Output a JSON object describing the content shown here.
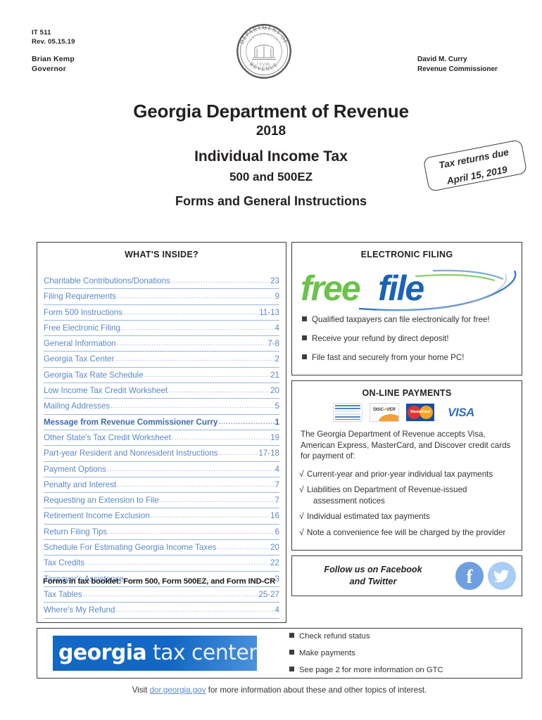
{
  "header": {
    "form_number": "IT 511",
    "revision": "Rev. 05.15.19",
    "governor_name": "Brian Kemp",
    "governor_title": "Governor",
    "commissioner_name": "David M. Curry",
    "commissioner_title": "Revenue Commissioner",
    "seal_outer_top": "DEPARTMENT OF",
    "seal_outer_bottom": "REVENUE",
    "seal_inner_top": "STATE OF GEORGIA",
    "seal_year": "1776"
  },
  "title": {
    "line1": "Georgia Department of Revenue",
    "line2": "2018",
    "line3": "Individual Income Tax",
    "line4": "500 and 500EZ",
    "line5": "Forms and General Instructions"
  },
  "due_badge": {
    "line1": "Tax returns due",
    "line2": "April 15, 2019"
  },
  "whats_inside": {
    "heading": "WHAT'S INSIDE?",
    "items": [
      {
        "label": "Charitable Contributions/Donations",
        "page": "23",
        "bold": false
      },
      {
        "label": "Filing Requirements",
        "page": "9",
        "bold": false
      },
      {
        "label": "Form 500 Instructions",
        "page": "11-13",
        "bold": false
      },
      {
        "label": "Free Electronic Filing",
        "page": "4",
        "bold": false
      },
      {
        "label": "General Information",
        "page": "7-8",
        "bold": false
      },
      {
        "label": "Georgia Tax Center",
        "page": "2",
        "bold": false
      },
      {
        "label": "Georgia Tax Rate Schedule",
        "page": "21",
        "bold": false
      },
      {
        "label": "Low Income Tax Credit Worksheet",
        "page": "20",
        "bold": false
      },
      {
        "label": "Mailing Addresses",
        "page": "5",
        "bold": false
      },
      {
        "label": "Message from Revenue Commissioner Curry",
        "page": "1",
        "bold": true
      },
      {
        "label": "Other State's Tax Credit Worksheet",
        "page": "19",
        "bold": false
      },
      {
        "label": "Part-year Resident and Nonresident Instructions",
        "page": "17-18",
        "bold": false
      },
      {
        "label": "Payment Options",
        "page": "4",
        "bold": false
      },
      {
        "label": "Penalty and Interest",
        "page": "7",
        "bold": false
      },
      {
        "label": "Requesting an Extension to File",
        "page": "7",
        "bold": false
      },
      {
        "label": "Retirement Income Exclusion",
        "page": "16",
        "bold": false
      },
      {
        "label": "Return Filing Tips",
        "page": "6",
        "bold": false
      },
      {
        "label": "Schedule For Estimating Georgia Income Taxes",
        "page": "20",
        "bold": false
      },
      {
        "label": "Tax Credits",
        "page": "22",
        "bold": false
      },
      {
        "label": "Taxpayer's Assistance",
        "page": "3",
        "bold": false
      },
      {
        "label": "Tax Tables",
        "page": "25-27",
        "bold": false
      },
      {
        "label": "Where's My Refund",
        "page": "4",
        "bold": false
      }
    ],
    "forms_note": "Forms in tax booklet: Form 500, Form 500EZ, and  Form IND-CR"
  },
  "electronic_filing": {
    "heading": "ELECTRONIC FILING",
    "logo_free": "free",
    "logo_file": "file",
    "bullets": [
      "Qualified taxpayers can file electronically for free!",
      "Receive your refund by direct deposit!",
      "File fast and securely from your home PC!"
    ]
  },
  "online_payments": {
    "heading": "ON-LINE PAYMENTS",
    "cards": [
      {
        "name": "american-express",
        "label": "AMERICAN EXPRESS"
      },
      {
        "name": "discover",
        "label": "DISCOVER"
      },
      {
        "name": "mastercard",
        "label": "MasterCard"
      },
      {
        "name": "visa",
        "label": "VISA"
      }
    ],
    "intro": "The Georgia Department of Revenue accepts Visa, American Express, MasterCard, and Discover credit cards for payment of:",
    "check_symbol": "√",
    "items": [
      {
        "text": "Current-year and prior-year individual tax payments",
        "sub": ""
      },
      {
        "text": "Liabilities on Department of Revenue-issued",
        "sub": "assessment notices"
      },
      {
        "text": "Individual estimated tax payments",
        "sub": ""
      },
      {
        "text": "Note a convenience fee will be charged by the provider",
        "sub": ""
      }
    ]
  },
  "social": {
    "line1": "Follow us on Facebook",
    "line2": "and Twitter",
    "facebook_glyph": "f",
    "twitter_glyph": "🐦"
  },
  "bottom": {
    "banner_word1": "georgia",
    "banner_word2": " tax center",
    "bullets": [
      "Check refund status",
      "Make payments",
      "See page 2 for more information on GTC"
    ]
  },
  "footer": {
    "before": "Visit ",
    "link": "dor.georgia.gov",
    "after": " for more information about these and other topics of interest."
  },
  "colors": {
    "link_blue": "#5b87c9",
    "gtc_blue": "#1268c4",
    "free_green": "#6cc24a",
    "file_blue": "#1b63b5",
    "border": "#3a3a3a"
  }
}
